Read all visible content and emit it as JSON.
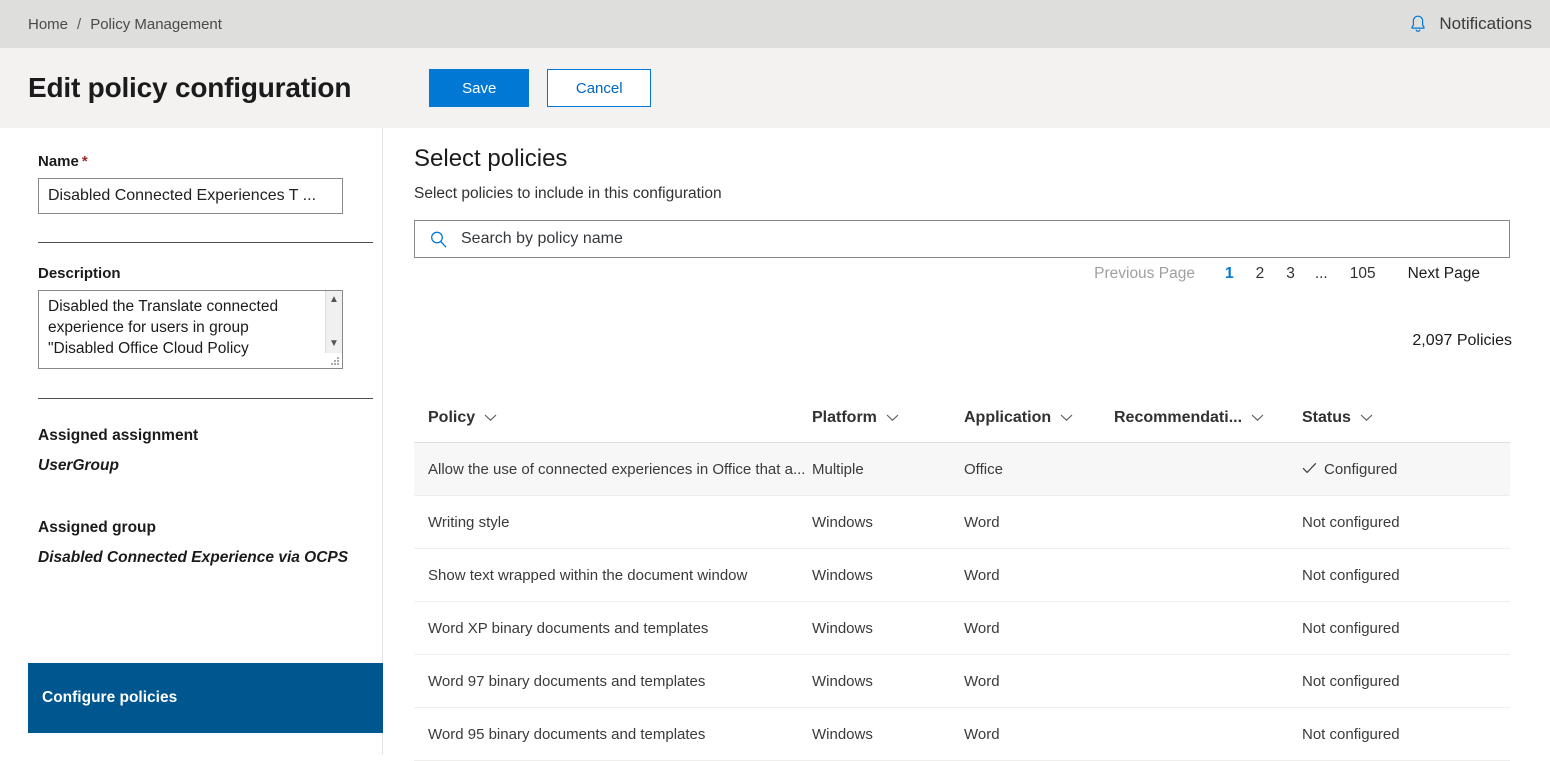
{
  "topbar": {
    "breadcrumb": {
      "home": "Home",
      "separator": "/",
      "current": "Policy Management"
    },
    "notifications_label": "Notifications",
    "notifications_icon": "bell-icon",
    "accent_blue": "#0078d4"
  },
  "header": {
    "title": "Edit policy configuration",
    "save_label": "Save",
    "cancel_label": "Cancel"
  },
  "left_panel": {
    "name_label": "Name",
    "required_marker": "*",
    "name_value": "Disabled Connected Experiences T ...",
    "description_label": "Description",
    "description_value": "Disabled the Translate connected experience for users in group \"Disabled Office Cloud Policy",
    "assigned_assignment_label": "Assigned assignment",
    "assigned_assignment_value": "UserGroup",
    "assigned_group_label": "Assigned group",
    "assigned_group_value": "Disabled Connected Experience via OCPS",
    "configure_policies_label": "Configure policies",
    "configure_bar_color": "#00568f"
  },
  "main": {
    "heading": "Select policies",
    "subheading": "Select policies to include in this configuration",
    "search": {
      "placeholder": "Search by policy name",
      "value": "",
      "icon": "search-icon"
    },
    "pagination": {
      "previous_label": "Previous Page",
      "pages": [
        "1",
        "2",
        "3"
      ],
      "ellipsis": "...",
      "last_page": "105",
      "next_label": "Next Page",
      "active_page": "1"
    },
    "count_text": "2,097 Policies",
    "table": {
      "columns": [
        {
          "label": "Policy",
          "sort_icon": "chevron-down-icon"
        },
        {
          "label": "Platform",
          "sort_icon": "chevron-down-icon"
        },
        {
          "label": "Application",
          "sort_icon": "chevron-down-icon"
        },
        {
          "label": "Recommendati...",
          "sort_icon": "chevron-down-icon"
        },
        {
          "label": "Status",
          "sort_icon": "chevron-down-icon"
        }
      ],
      "rows": [
        {
          "policy": "Allow the use of connected experiences in Office that a...",
          "platform": "Multiple",
          "application": "Office",
          "recommendation": "",
          "status": "Configured",
          "status_icon": "checkmark-icon",
          "selected": true
        },
        {
          "policy": "Writing style",
          "platform": "Windows",
          "application": "Word",
          "recommendation": "",
          "status": "Not configured",
          "status_icon": "",
          "selected": false
        },
        {
          "policy": "Show text wrapped within the document window",
          "platform": "Windows",
          "application": "Word",
          "recommendation": "",
          "status": "Not configured",
          "status_icon": "",
          "selected": false
        },
        {
          "policy": "Word XP binary documents and templates",
          "platform": "Windows",
          "application": "Word",
          "recommendation": "",
          "status": "Not configured",
          "status_icon": "",
          "selected": false
        },
        {
          "policy": "Word 97 binary documents and templates",
          "platform": "Windows",
          "application": "Word",
          "recommendation": "",
          "status": "Not configured",
          "status_icon": "",
          "selected": false
        },
        {
          "policy": "Word 95 binary documents and templates",
          "platform": "Windows",
          "application": "Word",
          "recommendation": "",
          "status": "Not configured",
          "status_icon": "",
          "selected": false
        }
      ]
    }
  }
}
